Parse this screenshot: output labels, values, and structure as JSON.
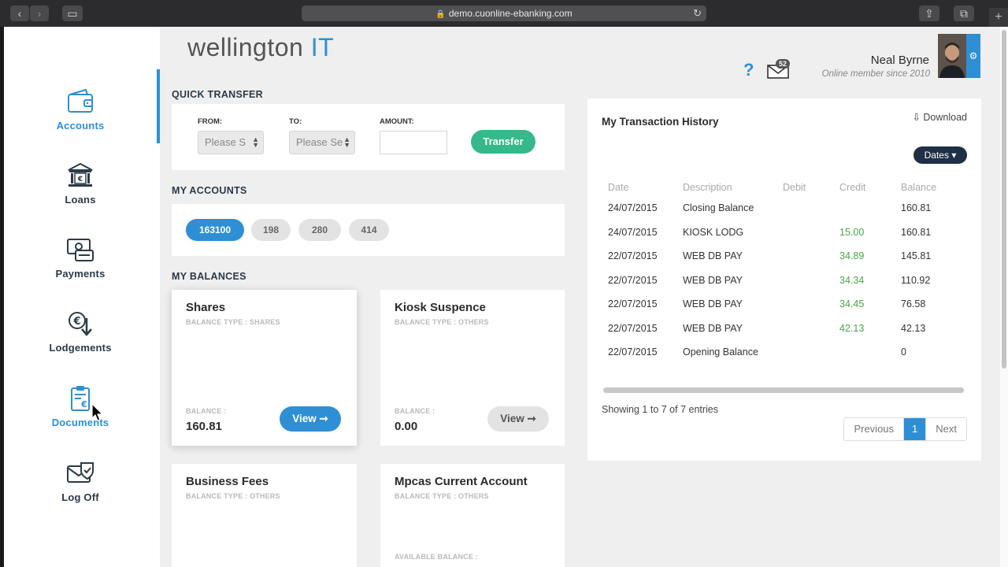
{
  "browser": {
    "url": "demo.cuonline-ebanking.com"
  },
  "brand": {
    "name_main": "wellington",
    "name_accent": "IT",
    "accent_color": "#2e8fd5",
    "success_color": "#35b98b"
  },
  "sidebar": {
    "items": [
      {
        "label": "Accounts",
        "icon": "wallet-icon",
        "active": true
      },
      {
        "label": "Loans",
        "icon": "bank-icon"
      },
      {
        "label": "Payments",
        "icon": "money-icon"
      },
      {
        "label": "Lodgements",
        "icon": "euro-deposit-icon"
      },
      {
        "label": "Documents",
        "icon": "clipboard-euro-icon"
      },
      {
        "label": "Log Off",
        "icon": "logoff-icon"
      }
    ]
  },
  "header": {
    "help_label": "?",
    "mail_count": "52",
    "user_name": "Neal Byrne",
    "member_since": "Online member since 2010"
  },
  "quick_transfer": {
    "title": "QUICK TRANSFER",
    "from_label": "FROM:",
    "to_label": "TO:",
    "amount_label": "AMOUNT:",
    "from_value": "Please S",
    "to_value": "Please Se",
    "amount_value": "",
    "button_label": "Transfer"
  },
  "my_accounts": {
    "title": "MY ACCOUNTS",
    "accounts": [
      "163100",
      "198",
      "280",
      "414"
    ]
  },
  "my_balances": {
    "title": "MY BALANCES",
    "cards": [
      {
        "name": "Shares",
        "type": "BALANCE TYPE : SHARES",
        "balance_caption": "BALANCE :",
        "balance": "160.81",
        "button": "View ➞"
      },
      {
        "name": "Kiosk Suspence",
        "type": "BALANCE TYPE : OTHERS",
        "balance_caption": "BALANCE :",
        "balance": "0.00",
        "button": "View ➞"
      },
      {
        "name": "Business Fees",
        "type": "BALANCE TYPE : OTHERS"
      },
      {
        "name": "Mpcas Current Account",
        "type": "BALANCE TYPE : OTHERS",
        "balance_caption": "AVAILABLE BALANCE :"
      }
    ]
  },
  "history": {
    "title": "My Transaction History",
    "download_label": "Download",
    "dates_label": "Dates",
    "columns": [
      "Date",
      "Description",
      "Debit",
      "Credit",
      "Balance"
    ],
    "rows": [
      {
        "date": "24/07/2015",
        "description": "Closing Balance",
        "debit": "",
        "credit": "",
        "balance": "160.81"
      },
      {
        "date": "24/07/2015",
        "description": "KIOSK LODG",
        "debit": "",
        "credit": "15.00",
        "balance": "160.81"
      },
      {
        "date": "22/07/2015",
        "description": "WEB DB PAY",
        "debit": "",
        "credit": "34.89",
        "balance": "145.81"
      },
      {
        "date": "22/07/2015",
        "description": "WEB DB PAY",
        "debit": "",
        "credit": "34.34",
        "balance": "110.92"
      },
      {
        "date": "22/07/2015",
        "description": "WEB DB PAY",
        "debit": "",
        "credit": "34.45",
        "balance": "76.58"
      },
      {
        "date": "22/07/2015",
        "description": "WEB DB PAY",
        "debit": "",
        "credit": "42.13",
        "balance": "42.13"
      },
      {
        "date": "22/07/2015",
        "description": "Opening Balance",
        "debit": "",
        "credit": "",
        "balance": "0"
      }
    ],
    "showing": "Showing 1 to 7 of 7 entries",
    "pagination": {
      "previous": "Previous",
      "current": "1",
      "next": "Next"
    }
  }
}
